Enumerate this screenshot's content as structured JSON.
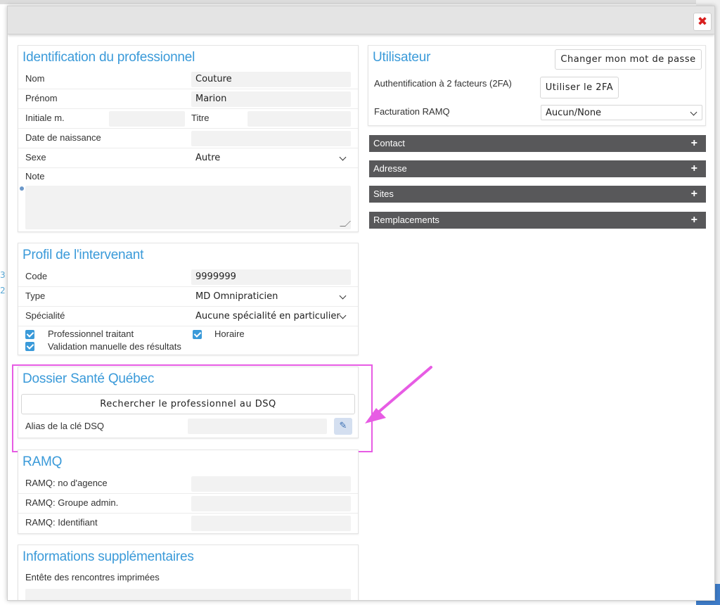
{
  "close_label": "✖",
  "identification": {
    "title": "Identification du professionnel",
    "nom_label": "Nom",
    "nom_value": "Couture",
    "prenom_label": "Prénom",
    "prenom_value": "Marion",
    "initiale_label": "Initiale m.",
    "titre_label": "Titre",
    "naissance_label": "Date de naissance",
    "sexe_label": "Sexe",
    "sexe_value": "Autre",
    "note_label": "Note"
  },
  "profil": {
    "title": "Profil de l'intervenant",
    "code_label": "Code",
    "code_value": "9999999",
    "type_label": "Type",
    "type_value": "MD Omnipraticien",
    "specialite_label": "Spécialité",
    "specialite_value": "Aucune spécialité en particulier",
    "traitant_label": "Professionnel traitant",
    "horaire_label": "Horaire",
    "validation_label": "Validation manuelle des résultats"
  },
  "dsq": {
    "title": "Dossier Santé Québec",
    "search_button": "Rechercher le professionnel au DSQ",
    "alias_label": "Alias de la clé DSQ"
  },
  "ramq": {
    "title": "RAMQ",
    "agence_label": "RAMQ: no d'agence",
    "groupe_label": "RAMQ: Groupe admin.",
    "identifiant_label": "RAMQ: Identifiant"
  },
  "info_supp": {
    "title": "Informations supplémentaires",
    "entete_label": "Entête des rencontres imprimées"
  },
  "utilisateur": {
    "title": "Utilisateur",
    "change_pw_button": "Changer mon mot de passe",
    "twofa_label": "Authentification à 2 facteurs (2FA)",
    "twofa_button": "Utiliser le 2FA",
    "facturation_label": "Facturation RAMQ",
    "facturation_value": "Aucun/None"
  },
  "sections": {
    "contact": "Contact",
    "adresse": "Adresse",
    "sites": "Sites",
    "remplacements": "Remplacements"
  },
  "background_fragments": [
    "3",
    "2"
  ],
  "colors": {
    "accent": "#3a9ad9",
    "highlight": "#e75ce4",
    "section_bar": "#58585a",
    "close": "#d8201f"
  }
}
